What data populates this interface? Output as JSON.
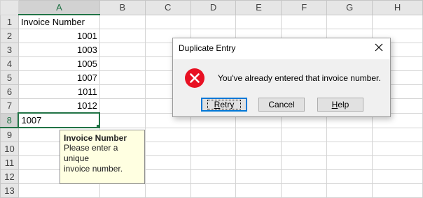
{
  "columns": [
    "A",
    "B",
    "C",
    "D",
    "E",
    "F",
    "G",
    "H"
  ],
  "rows": [
    {
      "num": "1",
      "a": "Invoice Number",
      "type": "txt"
    },
    {
      "num": "2",
      "a": "1001",
      "type": "num"
    },
    {
      "num": "3",
      "a": "1003",
      "type": "num"
    },
    {
      "num": "4",
      "a": "1005",
      "type": "num"
    },
    {
      "num": "5",
      "a": "1007",
      "type": "num"
    },
    {
      "num": "6",
      "a": "1011",
      "type": "num"
    },
    {
      "num": "7",
      "a": "1012",
      "type": "num"
    },
    {
      "num": "8",
      "a": "1007",
      "type": "txt",
      "active": true
    },
    {
      "num": "9",
      "a": "",
      "type": "txt"
    },
    {
      "num": "10",
      "a": "",
      "type": "txt"
    },
    {
      "num": "11",
      "a": "",
      "type": "txt"
    },
    {
      "num": "12",
      "a": "",
      "type": "txt"
    },
    {
      "num": "13",
      "a": "",
      "type": "txt"
    }
  ],
  "tooltip": {
    "title": "Invoice Number",
    "body_line1": "Please enter a unique",
    "body_line2": "invoice number."
  },
  "dialog": {
    "title": "Duplicate Entry",
    "message": "You've already entered that invoice number.",
    "icon": "error-icon",
    "buttons": {
      "retry": {
        "accel": "R",
        "rest": "etry"
      },
      "cancel": {
        "label": "Cancel"
      },
      "help": {
        "accel": "H",
        "rest": "elp"
      }
    }
  },
  "colors": {
    "accent": "#217346",
    "error": "#e81123",
    "focus": "#0078d7"
  }
}
